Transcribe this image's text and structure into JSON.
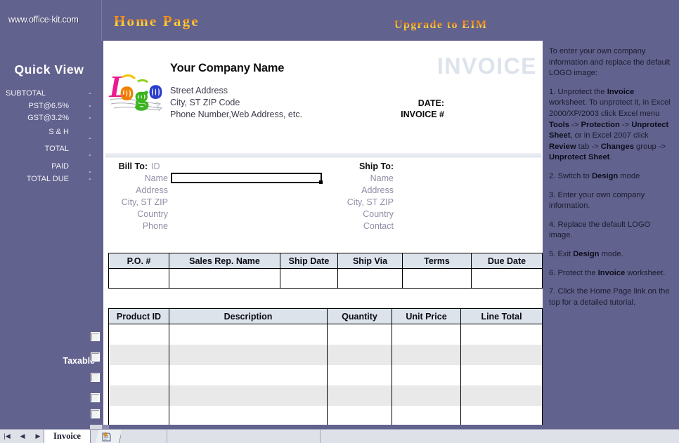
{
  "topbar": {
    "site_url": "www.office-kit.com",
    "home_page_link": "Home Page",
    "upgrade_link": "Upgrade to EIM"
  },
  "quick_view": {
    "title": "Quick  View",
    "rows": [
      {
        "label": "SUBTOTAL",
        "value": "-"
      },
      {
        "label": "PST@6.5%",
        "value": "-"
      },
      {
        "label": "GST@3.2%",
        "value": "-"
      },
      {
        "label": "S & H",
        "value": "-"
      },
      {
        "label": "TOTAL",
        "value": "-"
      },
      {
        "label": "PAID",
        "value": "-"
      },
      {
        "label": "TOTAL DUE",
        "value": "-"
      }
    ],
    "taxable_label": "Taxable",
    "taxable_checkbox_count": 6
  },
  "invoice": {
    "logo_alt": "Logo",
    "company_name": "Your Company Name",
    "address_line1": "Street Address",
    "address_line2": "City, ST  ZIP Code",
    "address_line3": "Phone Number,Web Address, etc.",
    "title_watermark": "INVOICE",
    "date_label": "DATE:",
    "invoice_number_label": "INVOICE #",
    "bill_to": {
      "heading": "Bill To:",
      "id": "ID",
      "fields": [
        "Name",
        "Address",
        "City, ST ZIP",
        "Country",
        "Phone"
      ]
    },
    "ship_to": {
      "heading": "Ship To:",
      "fields": [
        "Name",
        "Address",
        "City, ST ZIP",
        "Country",
        "Contact"
      ]
    },
    "order_table": {
      "headers": [
        "P.O. #",
        "Sales Rep. Name",
        "Ship Date",
        "Ship Via",
        "Terms",
        "Due Date"
      ],
      "rows": [
        [
          "",
          "",
          "",
          "",
          "",
          ""
        ]
      ]
    },
    "line_items_table": {
      "headers": [
        "Product ID",
        "Description",
        "Quantity",
        "Unit Price",
        "Line Total"
      ],
      "rows": [
        [
          "",
          "",
          "",
          "",
          ""
        ],
        [
          "",
          "",
          "",
          "",
          ""
        ],
        [
          "",
          "",
          "",
          "",
          ""
        ],
        [
          "",
          "",
          "",
          "",
          ""
        ],
        [
          "",
          "",
          "",
          "",
          ""
        ],
        [
          "",
          "",
          "",
          "",
          ""
        ]
      ]
    }
  },
  "instructions": {
    "intro": "To enter your own company information and replace the default LOGO image:",
    "steps": [
      "1. Unprotect the <b>Invoice</b> worksheet. To unprotect it, in Excel 2000/XP/2003 click Excel menu <b>Tools</b> -> <b>Protection</b> -> <b>Unprotect Sheet</b>, or in Excel 2007 click <b>Review</b> tab -> <b>Changes</b> group -> <b>Unprotect Sheet</b>.",
      "2. Switch to <b>Design</b> mode",
      "3. Enter your own company information.",
      "4. Replace the default LOGO image.",
      "5. Exit <b>Design</b> mode.",
      "6. Protect the <b>Invoice</b> worksheet.",
      "7. Click the Home Page link on the top for a detailed tutorial."
    ]
  },
  "bottom_bar": {
    "nav_first": "|◀",
    "nav_prev": "◀",
    "nav_next": "▶",
    "nav_last": "▶|",
    "active_sheet_tab": "Invoice",
    "scroll_grip": "||||"
  },
  "colors": {
    "panel_purple": "#62628f",
    "accent_orange": "#f58a10",
    "table_header": "#dce3ea",
    "alt_row": "#e9e9e9",
    "watermark": "#dde3ec"
  }
}
